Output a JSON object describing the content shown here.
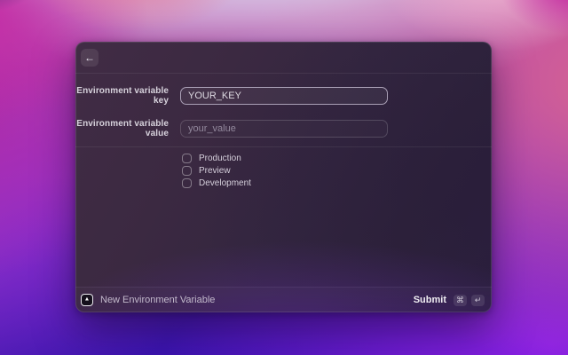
{
  "icons": {
    "back": "←",
    "app_triangle": "▲",
    "command": "⌘",
    "return": "↵"
  },
  "form": {
    "key_field": {
      "label": "Environment variable key",
      "value": "YOUR_KEY"
    },
    "value_field": {
      "label": "Environment variable value",
      "placeholder": "your_value"
    },
    "environments": [
      {
        "label": "Production",
        "checked": false
      },
      {
        "label": "Preview",
        "checked": false
      },
      {
        "label": "Development",
        "checked": false
      }
    ]
  },
  "footer": {
    "command_name": "New Environment Variable",
    "submit_label": "Submit",
    "shortcut_keys": [
      "⌘",
      "↵"
    ]
  },
  "colors": {
    "focused_input_border": "#aaa0b6",
    "window_bg": "#342745",
    "wallpaper_magenta": "#c22ba2",
    "wallpaper_violet": "#8c21e4",
    "wallpaper_indigo": "#3a11ae",
    "wallpaper_rose": "#d56392"
  }
}
